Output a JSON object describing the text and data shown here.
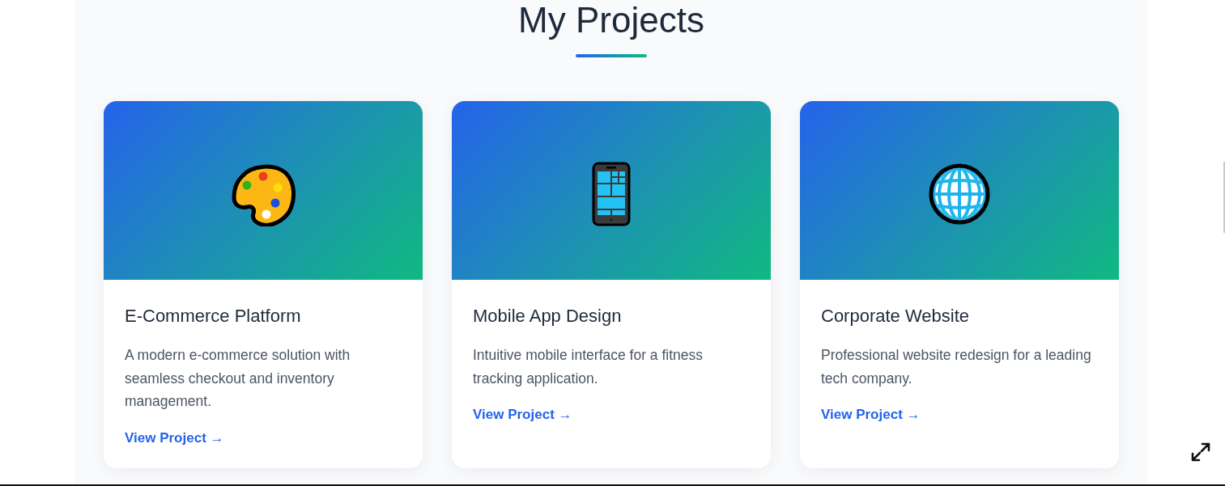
{
  "section": {
    "title": "My Projects"
  },
  "projects": [
    {
      "kind": "palette",
      "title": "E-Commerce Platform",
      "description": "A modern e-commerce solution with seamless checkout and inventory management.",
      "link": "View Project →"
    },
    {
      "kind": "phone",
      "title": "Mobile App Design",
      "description": "Intuitive mobile interface for a fitness tracking application.",
      "link": "View Project →"
    },
    {
      "kind": "globe",
      "title": "Corporate Website",
      "description": "Professional website redesign for a leading tech company.",
      "link": "View Project →"
    }
  ]
}
